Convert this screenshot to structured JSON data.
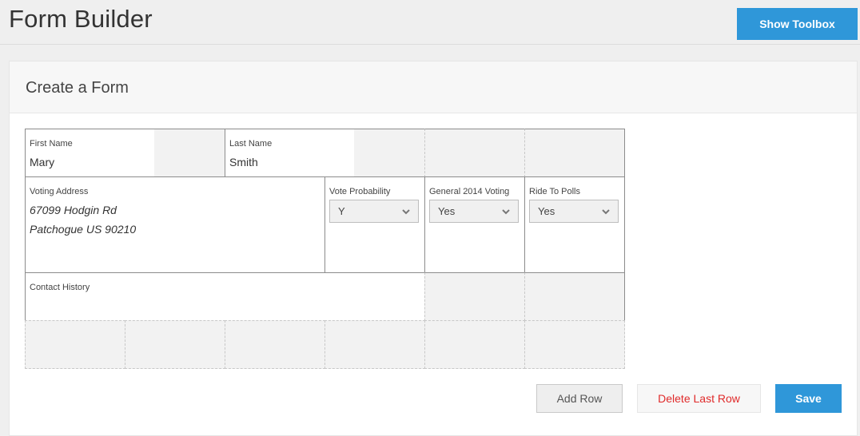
{
  "header": {
    "title": "Form Builder",
    "toolbox_button": "Show Toolbox"
  },
  "panel": {
    "title": "Create a Form"
  },
  "fields": {
    "first_name": {
      "label": "First Name",
      "value": "Mary"
    },
    "last_name": {
      "label": "Last Name",
      "value": "Smith"
    },
    "voting_address": {
      "label": "Voting Address",
      "line1": "67099 Hodgin Rd",
      "line2": "Patchogue US 90210"
    },
    "vote_probability": {
      "label": "Vote Probability",
      "value": "Y"
    },
    "general_2014_voting": {
      "label": "General 2014 Voting",
      "value": "Yes"
    },
    "ride_to_polls": {
      "label": "Ride To Polls",
      "value": "Yes"
    },
    "contact_history": {
      "label": "Contact History"
    }
  },
  "actions": {
    "add_row": "Add Row",
    "delete_last_row": "Delete Last Row",
    "save": "Save"
  },
  "colors": {
    "primary": "#2f97d9",
    "danger": "#e02a2a"
  }
}
